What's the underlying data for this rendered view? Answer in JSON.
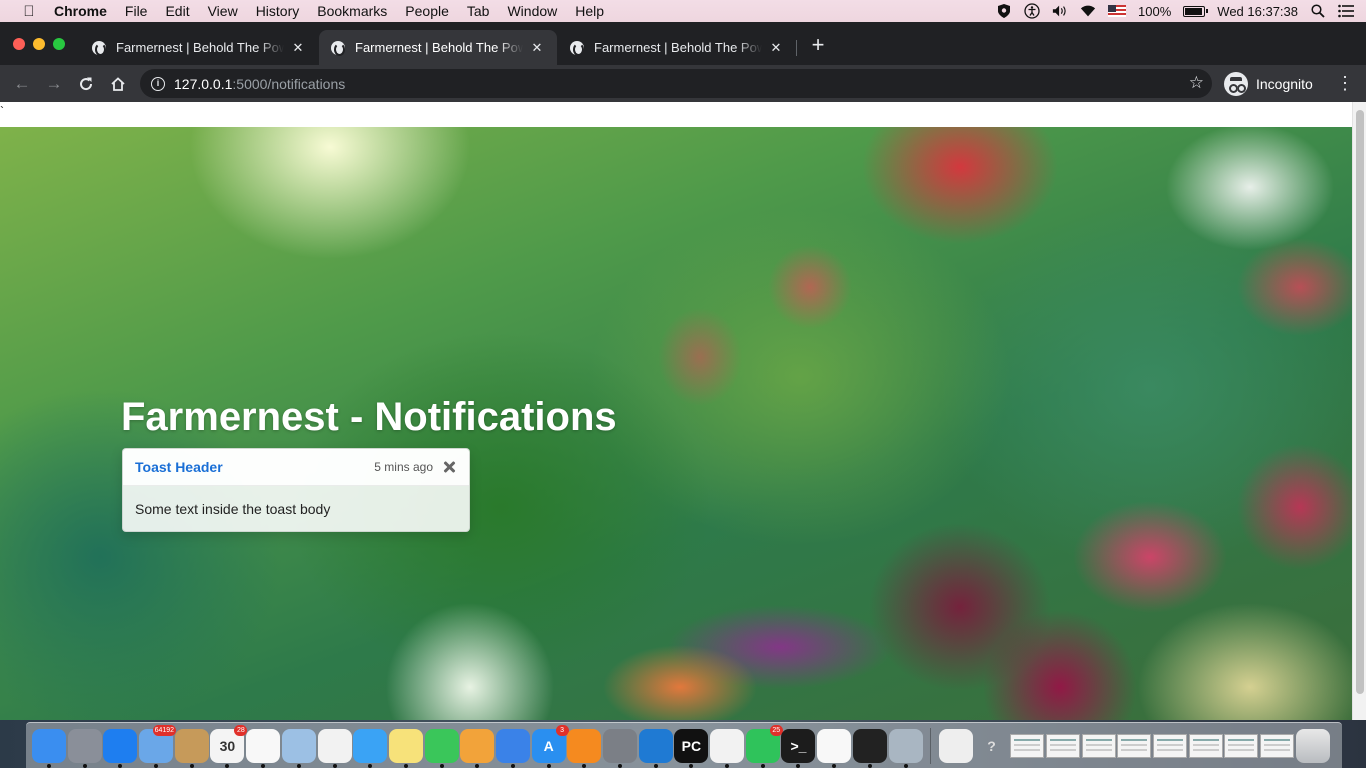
{
  "menubar": {
    "app_name": "Chrome",
    "items": [
      "File",
      "Edit",
      "View",
      "History",
      "Bookmarks",
      "People",
      "Tab",
      "Window",
      "Help"
    ],
    "battery": "100%",
    "battery_level": 1.0,
    "clock": "Wed 16:37:38",
    "icons": [
      "shield-icon",
      "accessibility-icon",
      "volume-icon",
      "wifi-icon",
      "us-flag-icon",
      "battery-icon",
      "spotlight-icon",
      "notification-center-icon"
    ]
  },
  "tabs": [
    {
      "title": "Farmernest | Behold The Power",
      "active": false
    },
    {
      "title": "Farmernest | Behold The Power",
      "active": true
    },
    {
      "title": "Farmernest | Behold The Power",
      "active": false
    }
  ],
  "toolbar": {
    "url_host": "127.0.0.1",
    "url_path": ":5000/notifications",
    "incognito_label": "Incognito"
  },
  "page": {
    "stray_char": "`",
    "heading": "Farmernest - Notifications",
    "toast": {
      "header": "Toast Header",
      "time": "5 mins ago",
      "body": "Some text inside the toast body"
    }
  },
  "dock": {
    "apps": [
      {
        "name": "finder",
        "color": "#3a8ef0",
        "label": ""
      },
      {
        "name": "launchpad",
        "color": "#8a8f99",
        "label": ""
      },
      {
        "name": "safari",
        "color": "#1e7ef0",
        "label": ""
      },
      {
        "name": "mail",
        "color": "#6aa7e8",
        "label": "",
        "badge": "64192"
      },
      {
        "name": "contacts",
        "color": "#c69a5a",
        "label": ""
      },
      {
        "name": "calendar",
        "color": "#f4f4f4",
        "label": "30",
        "badge": "28"
      },
      {
        "name": "reminders",
        "color": "#f8f8f8",
        "label": ""
      },
      {
        "name": "preview",
        "color": "#9cc0e4",
        "label": ""
      },
      {
        "name": "photos",
        "color": "#f2f2f2",
        "label": ""
      },
      {
        "name": "messages",
        "color": "#3aa3f5",
        "label": ""
      },
      {
        "name": "notes",
        "color": "#f7e27a",
        "label": ""
      },
      {
        "name": "facetime",
        "color": "#3ac65a",
        "label": ""
      },
      {
        "name": "pages",
        "color": "#f2a33a",
        "label": ""
      },
      {
        "name": "keynote",
        "color": "#3a82e8",
        "label": ""
      },
      {
        "name": "app-store",
        "color": "#2a8ff0",
        "label": "A",
        "badge": "3"
      },
      {
        "name": "books",
        "color": "#f58a1f",
        "label": ""
      },
      {
        "name": "system-preferences",
        "color": "#7b7f86",
        "label": ""
      },
      {
        "name": "vscode",
        "color": "#1f7ad3",
        "label": ""
      },
      {
        "name": "pycharm",
        "color": "#111111",
        "label": "PC"
      },
      {
        "name": "chrome",
        "color": "#f2f2f2",
        "label": ""
      },
      {
        "name": "whatsapp",
        "color": "#2fc35b",
        "label": "",
        "badge": "25"
      },
      {
        "name": "terminal",
        "color": "#1c1c1c",
        "label": ">_"
      },
      {
        "name": "textedit",
        "color": "#f8f8f8",
        "label": ""
      },
      {
        "name": "activity-monitor",
        "color": "#222222",
        "label": ""
      },
      {
        "name": "image-capture",
        "color": "#a9b6c2",
        "label": ""
      }
    ],
    "trash": "trash"
  }
}
